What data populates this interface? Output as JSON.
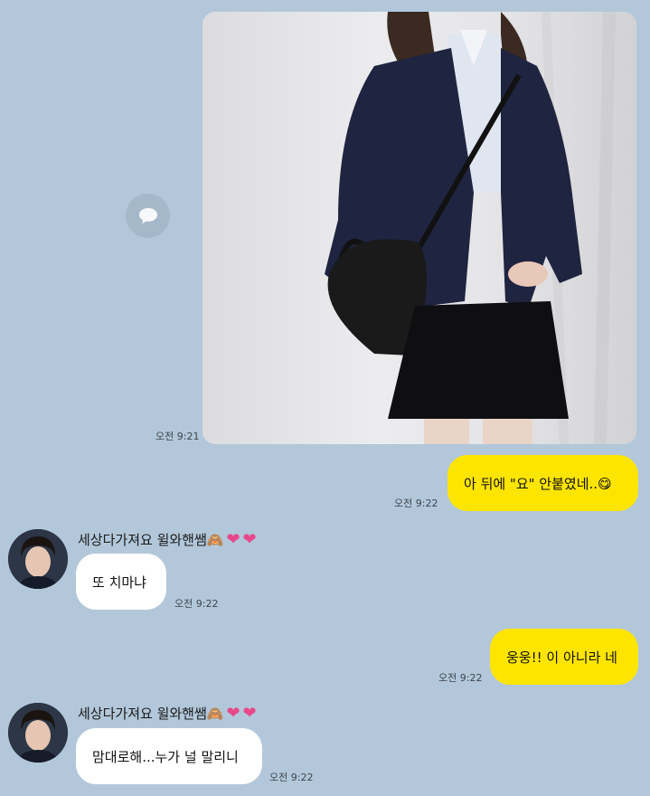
{
  "messages": [
    {
      "type": "image",
      "time": "오전 9:21"
    },
    {
      "type": "mine",
      "text": "아 뒤에 \"요\" 안붙였네..😋",
      "time": "오전 9:22"
    },
    {
      "type": "theirs",
      "sender": "세상다가져요 윌와핸쌤🙈",
      "text": "또 치마냐",
      "time": "오전 9:22"
    },
    {
      "type": "mine",
      "text": "웅웅!! 이 아니라 네",
      "time": "오전 9:22"
    },
    {
      "type": "theirs",
      "sender": "세상다가져요 윌와핸쌤🙈",
      "text": "맘대로해...누가 널 말리니",
      "time": "오전 9:22"
    }
  ],
  "icons": {
    "share": "speech-bubble-icon",
    "heart": "heart-icon"
  },
  "colors": {
    "background": "#b2c7da",
    "my_bubble": "#fee500",
    "their_bubble": "#ffffff",
    "heart": "#e8478b"
  }
}
